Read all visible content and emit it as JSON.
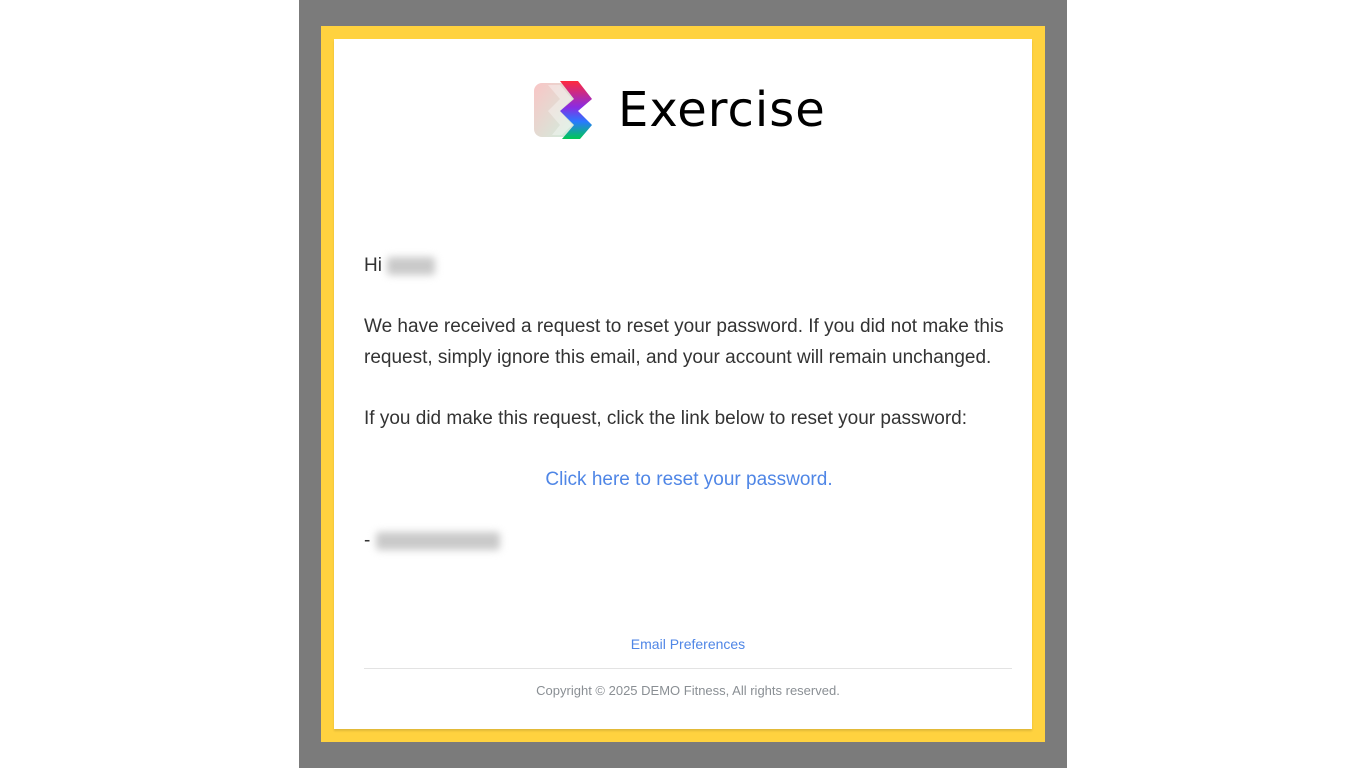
{
  "brand": {
    "name": "Exercise",
    "logo_icon": "exercise-logo-icon"
  },
  "email": {
    "greeting_prefix": "Hi",
    "paragraph1": "We have received a request to reset your password. If you did not make this request, simply ignore this email, and your account will remain unchanged.",
    "paragraph2": "If you did make this request, click the link below to reset your password:",
    "reset_link_label": "Click here to reset your password.",
    "signoff_prefix": "-"
  },
  "footer": {
    "preferences_label": "Email Preferences",
    "copyright": "Copyright © 2025 DEMO Fitness, All rights reserved."
  },
  "colors": {
    "backdrop": "#7b7b7b",
    "highlight_border": "#ffd23f",
    "link": "#4f86e6",
    "body_text": "#333333"
  }
}
